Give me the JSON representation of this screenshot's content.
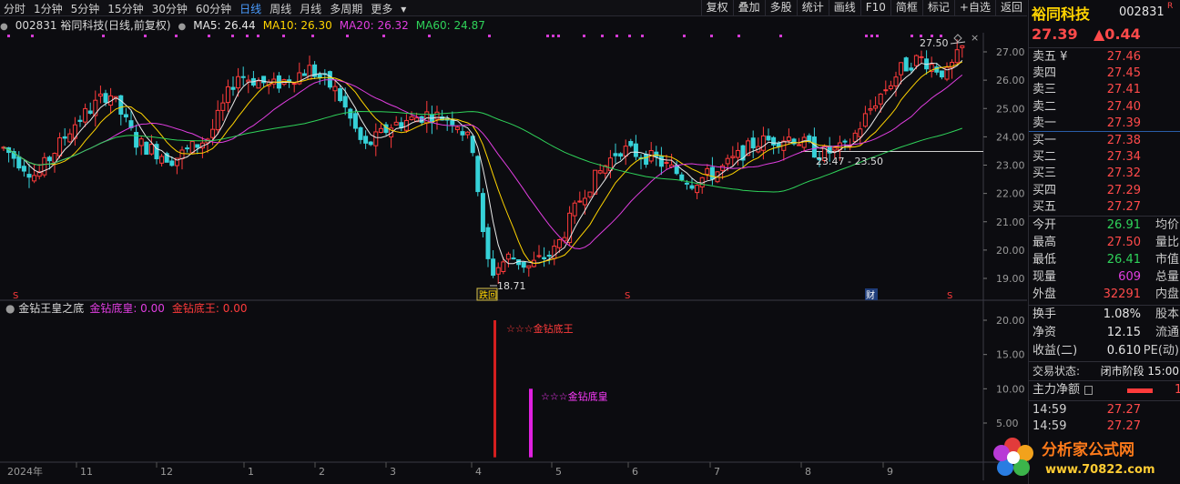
{
  "toolbar": {
    "periods": [
      "分时",
      "1分钟",
      "5分钟",
      "15分钟",
      "30分钟",
      "60分钟",
      "日线",
      "周线",
      "月线",
      "多周期",
      "更多"
    ],
    "active_period": "日线",
    "buttons": [
      "复权",
      "叠加",
      "多股",
      "统计",
      "画线",
      "F10",
      "简框",
      "标记",
      "+自选",
      "返回"
    ]
  },
  "info": {
    "code_name": "002831 裕同科技(日线,前复权)",
    "ma5": "MA5: 26.44",
    "ma10": "MA10: 26.30",
    "ma20": "MA20: 26.32",
    "ma60": "MA60: 24.87"
  },
  "indicator": {
    "name": "金钻王皇之底",
    "l1": "金钻底皇: 0.00",
    "l2": "金钻底王: 0.00",
    "label_king": "☆☆☆金钻底王",
    "label_emperor": "☆☆☆金钻底皇"
  },
  "chart_data": {
    "type": "candlestick",
    "price_axis": {
      "ticks": [
        "27.00",
        "26.00",
        "25.00",
        "24.00",
        "23.00",
        "22.00",
        "21.00",
        "20.00",
        "19.00"
      ]
    },
    "ind_axis": {
      "ticks": [
        "20.00",
        "15.00",
        "10.00",
        "5.00"
      ]
    },
    "x_labels": [
      "2024年",
      "11",
      "12",
      "1",
      "2",
      "3",
      "4",
      "5",
      "6",
      "7",
      "8",
      "9"
    ],
    "annotations": {
      "high": "27.50",
      "low": "18.71",
      "range": "23.47 - 23.50"
    },
    "markers": {
      "s": "S",
      "rebound": "跌回",
      "fin": "财"
    }
  },
  "panel": {
    "name": "裕同科技",
    "code": "002831",
    "tag": "R",
    "price": "27.39",
    "change": "▲0.44",
    "asks": [
      [
        "卖五 ¥",
        "27.46"
      ],
      [
        "卖四",
        "27.45"
      ],
      [
        "卖三",
        "27.41"
      ],
      [
        "卖二",
        "27.40"
      ],
      [
        "卖一",
        "27.39"
      ]
    ],
    "bids": [
      [
        "买一",
        "27.38"
      ],
      [
        "买二",
        "27.34"
      ],
      [
        "买三",
        "27.32"
      ],
      [
        "买四",
        "27.29"
      ],
      [
        "买五",
        "27.27"
      ]
    ],
    "stats": [
      [
        "今开",
        "26.91",
        "均价"
      ],
      [
        "最高",
        "27.50",
        "量比"
      ],
      [
        "最低",
        "26.41",
        "市值"
      ],
      [
        "现量",
        "609",
        "总量"
      ],
      [
        "外盘",
        "32291",
        "内盘"
      ]
    ],
    "stats2": [
      [
        "换手",
        "1.08%",
        "股本"
      ],
      [
        "净资",
        "12.15",
        "流通"
      ],
      [
        "收益(二)",
        "0.610",
        "PE(动)"
      ]
    ],
    "status_label": "交易状态:",
    "status_value": "闭市阶段 15:00",
    "mainforce_label": "主力净额",
    "ticks": [
      [
        "14:59",
        "27.27"
      ],
      [
        "14:59",
        "27.27"
      ]
    ],
    "watermark": "分析家公式网",
    "watermark_url": "www.70822.com"
  }
}
